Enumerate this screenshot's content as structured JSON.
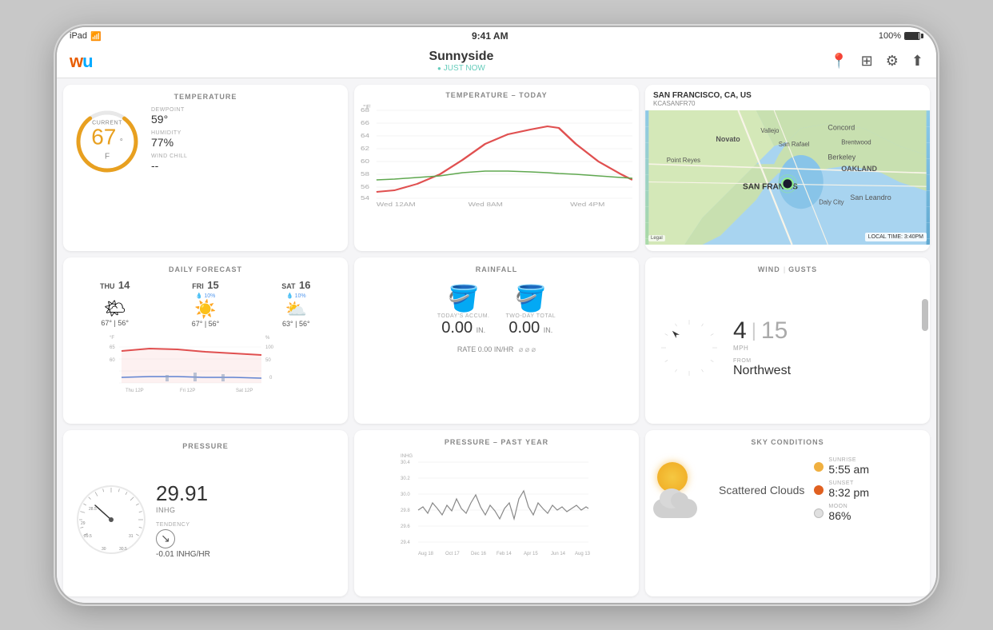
{
  "device": {
    "model": "iPad",
    "time": "9:41 AM",
    "battery": "100%",
    "signal": "wifi"
  },
  "nav": {
    "title": "Sunnyside",
    "subtitle": "JUST NOW",
    "icons": [
      "location",
      "layers",
      "settings",
      "share"
    ]
  },
  "temperature": {
    "title": "TEMPERATURE",
    "current_label": "CURRENT",
    "current_value": "67",
    "unit": "°F",
    "dewpoint_label": "DEWPOINT",
    "dewpoint_value": "59°",
    "humidity_label": "HUMIDITY",
    "humidity_value": "77%",
    "wind_chill_label": "WIND CHILL",
    "wind_chill_value": "--"
  },
  "temp_chart": {
    "title": "TEMPERATURE – TODAY",
    "y_min": 54,
    "y_max": 68,
    "x_labels": [
      "Wed 12AM",
      "Wed 8AM",
      "Wed 4PM"
    ],
    "y_labels": [
      "54",
      "56",
      "58",
      "60",
      "62",
      "64",
      "66",
      "68"
    ],
    "unit": "°F"
  },
  "map": {
    "title": "SAN FRANCISCO, CA, US",
    "station_id": "KCASANFR70",
    "timestamp": "LOCAL TIME: 3:40PM",
    "legal": "Legal"
  },
  "forecast": {
    "title": "DAILY FORECAST",
    "days": [
      {
        "name": "THU",
        "num": "14",
        "rain_pct": "",
        "high": "67°",
        "low": "56°",
        "icon": "🌤"
      },
      {
        "name": "FRI",
        "num": "15",
        "rain_pct": "10%",
        "high": "67°",
        "low": "56°",
        "icon": "☀"
      },
      {
        "name": "SAT",
        "num": "16",
        "rain_pct": "10%",
        "high": "63°",
        "low": "56°",
        "icon": "🌤"
      }
    ],
    "x_labels": [
      "Thu 12P",
      "Fri 12P",
      "Sat 12P"
    ],
    "y_labels": [
      "60",
      "65",
      "100",
      "50",
      "0"
    ]
  },
  "rainfall": {
    "title": "RAINFALL",
    "today_label": "TODAY'S ACCUM.",
    "today_value": "0.00",
    "today_unit": "IN.",
    "two_day_label": "TWO-DAY TOTAL",
    "two_day_value": "0.00",
    "two_day_unit": "IN.",
    "rate_label": "RATE",
    "rate_value": "0.00",
    "rate_unit": "IN/HR"
  },
  "wind": {
    "title": "WIND",
    "gusts_label": "GUSTS",
    "speed": "4",
    "gust": "15",
    "unit": "MPH",
    "from_label": "FROM",
    "from_value": "Northwest",
    "direction_deg": 315
  },
  "pressure": {
    "title": "PRESSURE",
    "value": "29.91",
    "unit": "INHG",
    "tendency_label": "TENDENCY",
    "tendency_value": "-0.01 INHG/HR",
    "tendency_icon": "↘"
  },
  "pressure_chart": {
    "title": "PRESSURE – PAST YEAR",
    "x_labels": [
      "Aug 18",
      "Oct 17",
      "Dec 16",
      "Feb 14",
      "Apr 15",
      "Jun 14",
      "Aug 13"
    ],
    "y_labels": [
      "29.4",
      "29.6",
      "29.8",
      "30.0",
      "30.2",
      "30.4"
    ],
    "unit": "INHG"
  },
  "sky": {
    "title": "SKY CONDITIONS",
    "condition": "Scattered Clouds",
    "sunrise_label": "SUNRISE",
    "sunrise_value": "5:55 am",
    "sunset_label": "SUNSET",
    "sunset_value": "8:32 pm",
    "moon_label": "MOON",
    "moon_value": "86%",
    "sunrise_color": "#f0b040",
    "sunset_color": "#e06020",
    "moon_color": "#e0e0e0"
  }
}
